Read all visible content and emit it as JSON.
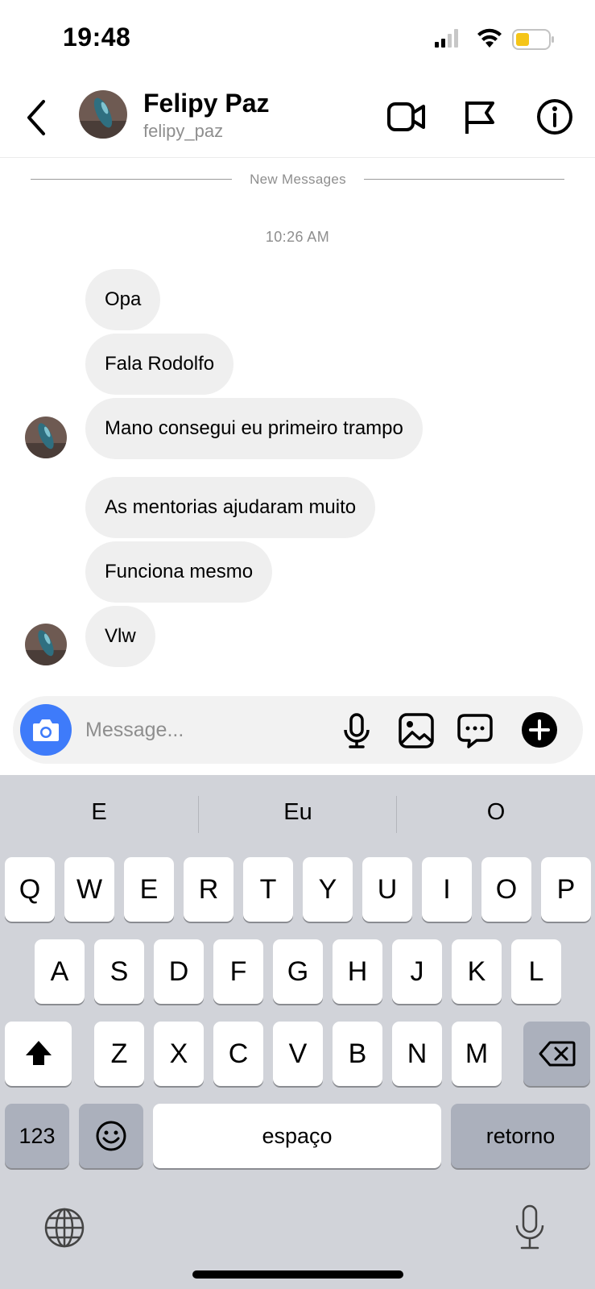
{
  "status_bar": {
    "time": "19:48",
    "icons": [
      "cellular-signal-icon",
      "wifi-icon",
      "battery-low-power-icon"
    ],
    "battery_color": "#f5c518"
  },
  "header": {
    "back_icon": "chevron-left-icon",
    "name": "Felipy Paz",
    "username": "felipy_paz",
    "actions": [
      "video-call-icon",
      "flag-icon",
      "info-icon"
    ]
  },
  "chat": {
    "divider_label": "New Messages",
    "timestamp": "10:26 AM",
    "groups": [
      {
        "messages": [
          "Opa",
          "Fala Rodolfo",
          "Mano consegui eu primeiro trampo"
        ]
      },
      {
        "messages": [
          "As mentorias ajudaram muito",
          "Funciona mesmo",
          "Vlw"
        ]
      }
    ],
    "bubble_color": "#efefef"
  },
  "composer": {
    "placeholder": "Message...",
    "camera_color": "#3e7bfa",
    "icons": [
      "microphone-icon",
      "gallery-icon",
      "sticker-chat-icon",
      "plus-circle-icon"
    ]
  },
  "keyboard": {
    "suggestions": [
      "E",
      "Eu",
      "O"
    ],
    "row1": [
      "Q",
      "W",
      "E",
      "R",
      "T",
      "Y",
      "U",
      "I",
      "O",
      "P"
    ],
    "row2": [
      "A",
      "S",
      "D",
      "F",
      "G",
      "H",
      "J",
      "K",
      "L"
    ],
    "row3": [
      "Z",
      "X",
      "C",
      "V",
      "B",
      "N",
      "M"
    ],
    "numbers_label": "123",
    "space_label": "espaço",
    "return_label": "retorno",
    "background": "#d1d3d9"
  }
}
